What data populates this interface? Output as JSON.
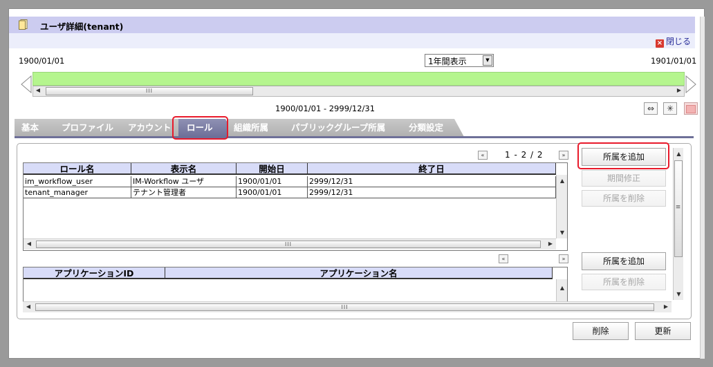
{
  "window": {
    "title": "ユーザ詳細(tenant)",
    "close_label": "閉じる"
  },
  "timeline": {
    "start_date": "1900/01/01",
    "end_date": "1901/01/01",
    "view_select": "1年間表示",
    "range_text": "1900/01/01 - 2999/12/31"
  },
  "tabs": [
    {
      "label": "基本"
    },
    {
      "label": "プロファイル"
    },
    {
      "label": "アカウント"
    },
    {
      "label": "ロール"
    },
    {
      "label": "組織所属"
    },
    {
      "label": "パブリックグループ所属"
    },
    {
      "label": "分類設定"
    }
  ],
  "roles": {
    "pager": "1 - 2 / 2",
    "columns": [
      "ロール名",
      "表示名",
      "開始日",
      "終了日"
    ],
    "rows": [
      [
        "im_workflow_user",
        "IM-Workflow ユーザ",
        "1900/01/01",
        "2999/12/31"
      ],
      [
        "tenant_manager",
        "テナント管理者",
        "1900/01/01",
        "2999/12/31"
      ]
    ],
    "buttons": {
      "add": "所属を追加",
      "period": "期間修正",
      "remove": "所属を削除"
    }
  },
  "apps": {
    "columns": [
      "アプリケーションID",
      "アプリケーション名"
    ],
    "buttons": {
      "add": "所属を追加",
      "remove": "所属を削除"
    }
  },
  "footer": {
    "delete": "削除",
    "update": "更新"
  },
  "colors": {
    "accent": "#6e7098",
    "timeline": "#b5f58e",
    "highlight": "#e8192a",
    "title_bg": "#ccccf0"
  }
}
